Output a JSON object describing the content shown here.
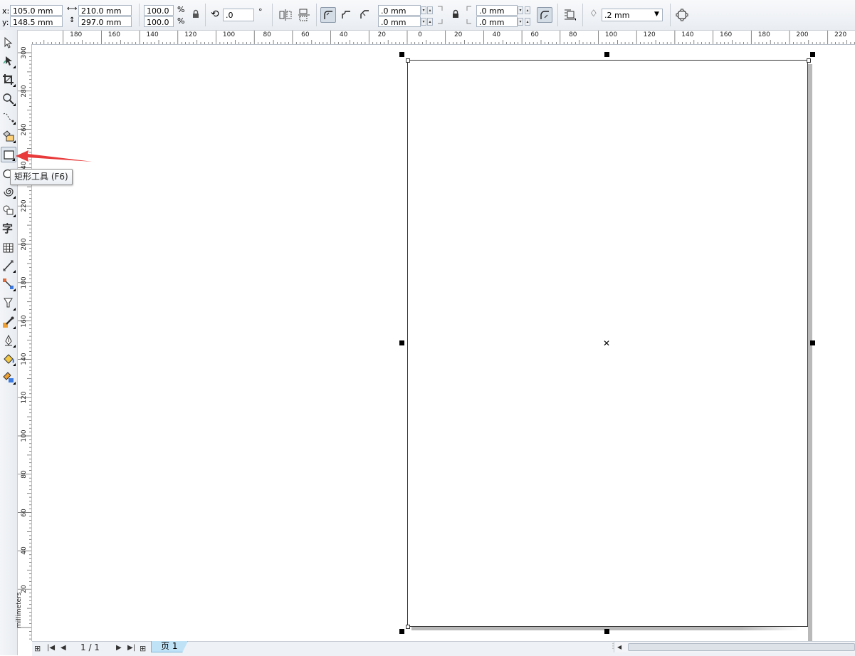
{
  "property_bar": {
    "x_label": "x:",
    "x_value": "105.0 mm",
    "y_label": "y:",
    "y_value": "148.5 mm",
    "width_value": "210.0 mm",
    "height_value": "297.0 mm",
    "scale_x": "100.0",
    "scale_y": "100.0",
    "percent_symbol": "%",
    "rotation_value": ".0",
    "degree_symbol": "°",
    "corner_radius_top_left": ".0 mm",
    "corner_radius_bottom_left": ".0 mm",
    "corner_radius_top_right": ".0 mm",
    "corner_radius_bottom_right": ".0 mm",
    "outline_width": ".2 mm"
  },
  "toolbox": {
    "tools": [
      "pick-tool",
      "shape-tool",
      "crop-tool",
      "zoom-tool",
      "freehand-tool",
      "smart-fill-tool",
      "rectangle-tool",
      "ellipse-tool",
      "spiral-tool",
      "basic-shapes-tool",
      "text-tool",
      "table-tool",
      "dimension-tool",
      "connector-tool",
      "blend-tool",
      "eyedropper-tool",
      "outline-pen-tool",
      "fill-tool",
      "interactive-fill-tool"
    ],
    "text_tool_glyph": "字",
    "selected_tool": "rectangle-tool"
  },
  "tooltip": {
    "text": "矩形工具 (F6)"
  },
  "ruler": {
    "horizontal_ticks": [
      "180",
      "160",
      "140",
      "120",
      "100",
      "80",
      "60",
      "40",
      "20",
      "0",
      "20",
      "40",
      "60",
      "80",
      "100",
      "120",
      "140",
      "160",
      "180",
      "200",
      "220"
    ],
    "vertical_ticks": [
      "300",
      "280",
      "260",
      "240",
      "220",
      "200",
      "180",
      "160",
      "140",
      "120",
      "100",
      "80",
      "60",
      "40",
      "20"
    ],
    "units": "millimeters"
  },
  "page_nav": {
    "counter": "1 / 1",
    "tab_label": "页 1"
  },
  "colors": {
    "arrow": "#e83a3a",
    "page_tab": "#bfe2f7",
    "chrome": "#e9edf2"
  }
}
